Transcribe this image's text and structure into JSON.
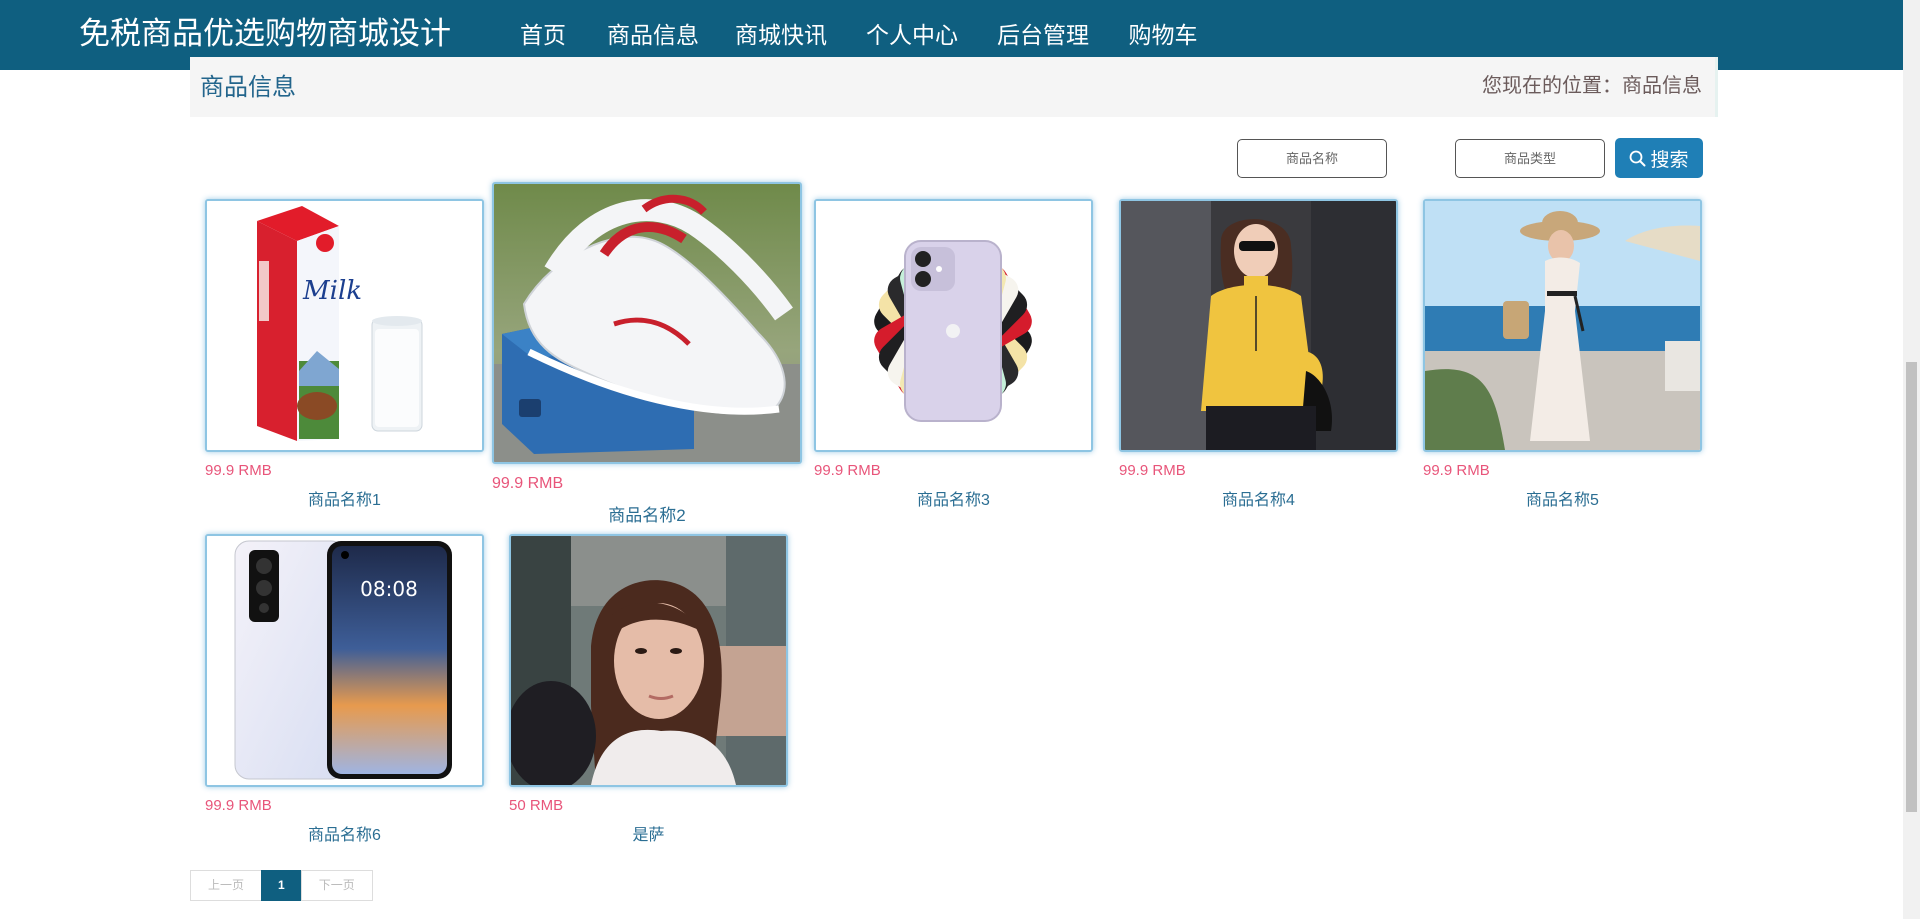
{
  "header": {
    "site_title": "免税商品优选购物商城设计",
    "nav": [
      "首页",
      "商品信息",
      "商城快讯",
      "个人中心",
      "后台管理",
      "购物车"
    ],
    "active_nav": "商品信息"
  },
  "titlebar": {
    "title": "商品信息",
    "location_label": "您现在的位置：",
    "location_current": "商品信息"
  },
  "search": {
    "name_placeholder": "商品名称",
    "type_placeholder": "商品类型",
    "button_label": "搜索"
  },
  "products": [
    {
      "price": "99.9 RMB",
      "name": "商品名称1",
      "image": "milk-carton-and-glass"
    },
    {
      "price": "99.9 RMB",
      "name": "商品名称2",
      "image": "white-sneaker-on-shoebox"
    },
    {
      "price": "99.9 RMB",
      "name": "商品名称3",
      "image": "smartphone-color-fan"
    },
    {
      "price": "99.9 RMB",
      "name": "商品名称4",
      "image": "woman-yellow-sweater"
    },
    {
      "price": "99.9 RMB",
      "name": "商品名称5",
      "image": "woman-white-dress-seaside"
    },
    {
      "price": "99.9 RMB",
      "name": "商品名称6",
      "image": "smartphone-front-and-back"
    },
    {
      "price": "50 RMB",
      "name": "是萨",
      "image": "woman-portrait"
    }
  ],
  "pagination": {
    "prev": "上一页",
    "current": "1",
    "next": "下一页"
  },
  "colors": {
    "header_bg": "#0f5f80",
    "accent": "#1f7fb6",
    "price": "#e8557a",
    "product_name": "#2b6e93"
  }
}
